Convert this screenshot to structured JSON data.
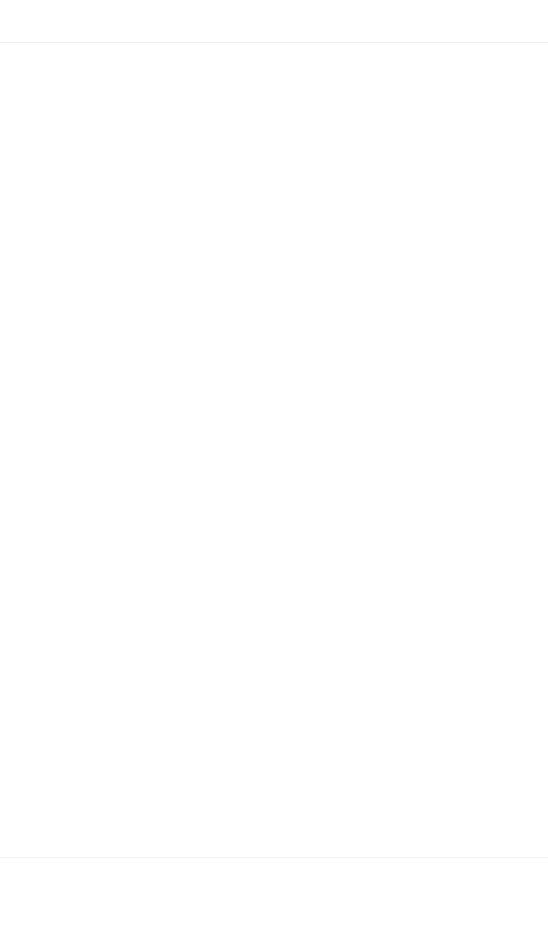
{
  "colors": {
    "background": "#ffffff",
    "divider": "#ededed"
  }
}
